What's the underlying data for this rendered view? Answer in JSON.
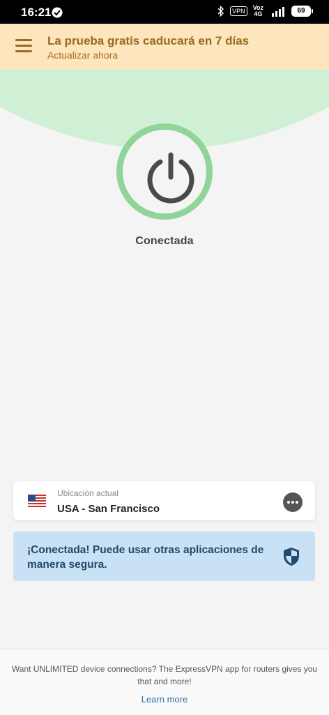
{
  "status_bar": {
    "time": "16:21",
    "vpn_badge": "VPN",
    "network_top": "Voz",
    "network_bottom": "4G",
    "battery": "69"
  },
  "banner": {
    "title": "La prueba gratis caducará en 7 días",
    "link": "Actualizar ahora",
    "color": "#9a6a1e"
  },
  "connection": {
    "status": "Conectada",
    "ring_color": "#8fd598",
    "icon": "power-icon"
  },
  "location": {
    "label": "Ubicación actual",
    "value": "USA - San Francisco",
    "flag": "us-flag-icon",
    "more_icon": "more-options-icon"
  },
  "info": {
    "message": "¡Conectada! Puede usar otras aplicaciones de manera segura.",
    "icon": "shield-icon"
  },
  "footer": {
    "promo": "Want UNLIMITED device connections? The ExpressVPN app for routers gives you that and more!",
    "link": "Learn more"
  }
}
